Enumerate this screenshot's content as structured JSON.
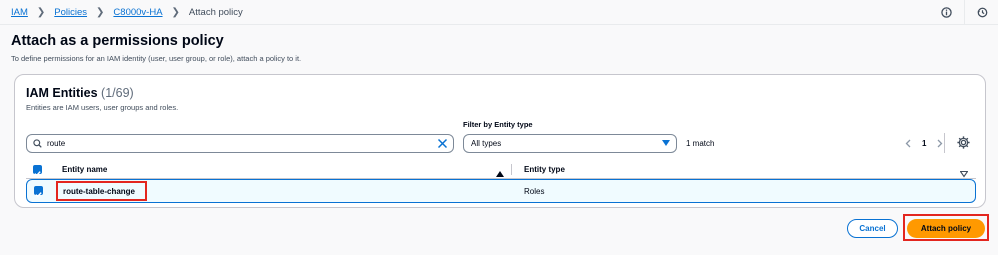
{
  "breadcrumb": {
    "items": [
      "IAM",
      "Policies",
      "C8000v-HA"
    ],
    "current": "Attach policy"
  },
  "header": {
    "icons": [
      "info-icon",
      "history-icon"
    ]
  },
  "page": {
    "title": "Attach as a permissions policy",
    "description": "To define permissions for an IAM identity (user, user group, or role), attach a policy to it."
  },
  "panel": {
    "title": "IAM Entities",
    "count": "(1/69)",
    "description": "Entities are IAM users, user groups and roles."
  },
  "search": {
    "value": "route",
    "icon": "search-icon",
    "clear_icon": "clear-icon"
  },
  "filter": {
    "label": "Filter by Entity type",
    "selected": "All types",
    "match_text": "1 match"
  },
  "pagination": {
    "current_page": "1"
  },
  "table": {
    "columns": [
      "Entity name",
      "Entity type"
    ],
    "rows": [
      {
        "name": "route-table-change",
        "type": "Roles",
        "selected": true
      }
    ]
  },
  "actions": {
    "cancel_label": "Cancel",
    "attach_label": "Attach policy"
  },
  "colors": {
    "link": "#0972d3",
    "primary_button": "#ff9900",
    "highlight_annotation": "#e3261f",
    "selected_row_bg": "#f0fbff"
  }
}
